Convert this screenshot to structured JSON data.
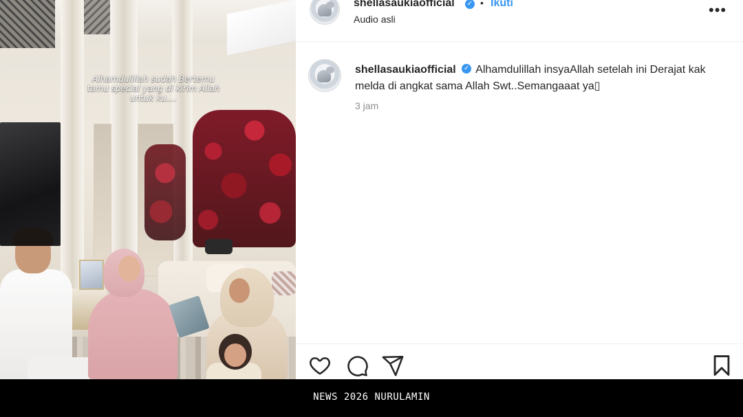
{
  "video": {
    "overlay_caption": "Alhamdulillah sudah Bertemu\ntamu special yang di kirim Allah\nuntuk ku...."
  },
  "header": {
    "username": "shellasaukiaofficial",
    "verified_icon": "verified-badge-icon",
    "separator": "•",
    "follow_label": "Ikuti",
    "audio_label": "Audio asli",
    "more_icon": "more-options-icon",
    "more_glyph": "•••"
  },
  "comment": {
    "username": "shellasaukiaofficial",
    "text": "Alhamdulillah insyaAllah setelah ini Derajat kak melda di angkat sama Allah Swt..Semangaaat ya▯",
    "time": "3 jam"
  },
  "actions": {
    "icons": [
      "heart-icon",
      "comment-icon",
      "share-icon",
      "bookmark-icon"
    ]
  },
  "footer": {
    "text": "NEWS 2026 NURULAMIN"
  },
  "colors": {
    "accent": "#3897f0",
    "text": "#262626",
    "muted": "#8e8e8e",
    "footer_bg": "#000000"
  }
}
